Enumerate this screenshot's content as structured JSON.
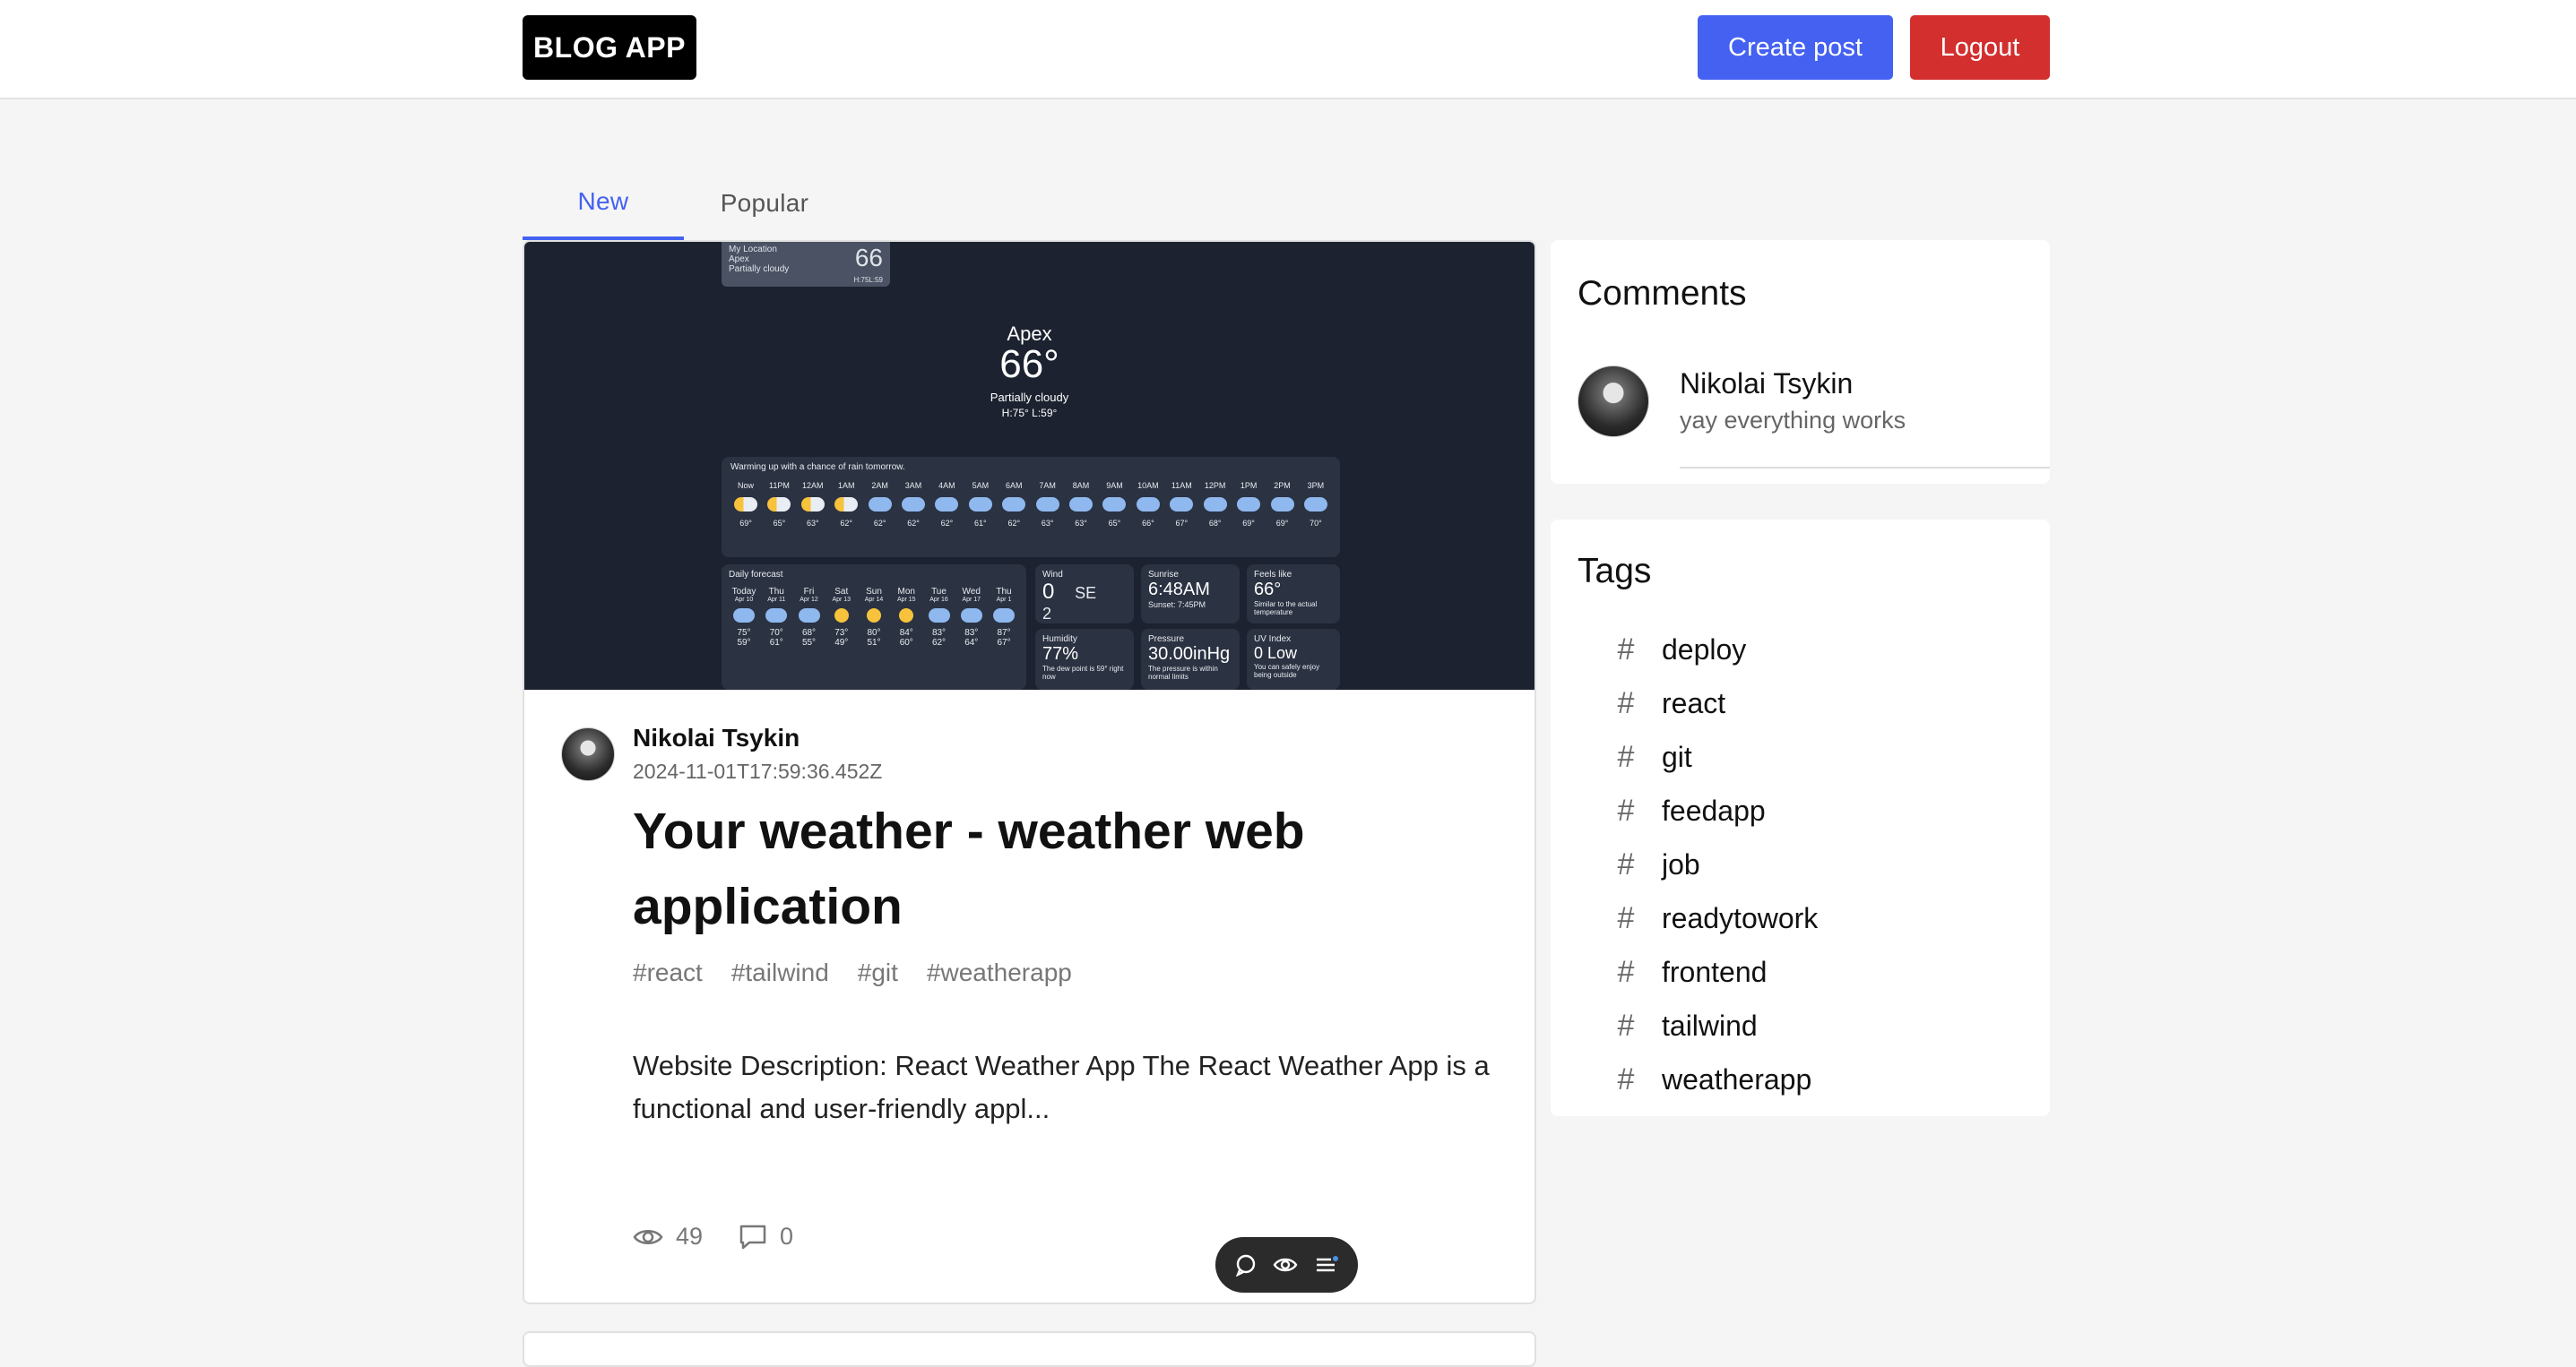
{
  "header": {
    "logo": "BLOG APP",
    "create_post": "Create post",
    "logout": "Logout"
  },
  "tabs": [
    {
      "label": "New",
      "active": true
    },
    {
      "label": "Popular",
      "active": false
    }
  ],
  "post": {
    "image": {
      "location_label": "My Location",
      "location_sub": "Apex",
      "location_cond": "Partially cloudy",
      "location_hl": "H:75L:59",
      "location_temp": "66",
      "city": "Apex",
      "temp": "66°",
      "condition": "Partially cloudy",
      "hilo": "H:75°  L:59°",
      "summary": "Warming up with a chance of rain tomorrow.",
      "hours": [
        "Now",
        "11PM",
        "12AM",
        "1AM",
        "2AM",
        "3AM",
        "4AM",
        "5AM",
        "6AM",
        "7AM",
        "8AM",
        "9AM",
        "10AM",
        "11AM",
        "12PM",
        "1PM",
        "2PM",
        "3PM"
      ],
      "hour_temps": [
        "69°",
        "65°",
        "63°",
        "62°",
        "62°",
        "62°",
        "62°",
        "61°",
        "62°",
        "63°",
        "63°",
        "65°",
        "66°",
        "67°",
        "68°",
        "69°",
        "69°",
        "70°"
      ],
      "daily_label": "Daily forecast",
      "days": [
        "Today",
        "Thu",
        "Fri",
        "Sat",
        "Sun",
        "Mon",
        "Tue",
        "Wed",
        "Thu"
      ],
      "day_dates": [
        "Apr 10",
        "Apr 11",
        "Apr 12",
        "Apr 13",
        "Apr 14",
        "Apr 15",
        "Apr 16",
        "Apr 17",
        "Apr 1"
      ],
      "day_highs": [
        "75°",
        "70°",
        "68°",
        "73°",
        "80°",
        "84°",
        "83°",
        "83°",
        "87°"
      ],
      "day_lows": [
        "59°",
        "61°",
        "55°",
        "49°",
        "51°",
        "60°",
        "62°",
        "64°",
        "67°"
      ],
      "wind_label": "Wind",
      "wind_value": "0",
      "gusts_value": "2",
      "wind_dir": "SE",
      "sunrise_label": "Sunrise",
      "sunrise_value": "6:48AM",
      "sunset": "Sunset: 7:45PM",
      "feels_label": "Feels like",
      "feels_value": "66°",
      "feels_note": "Similar to the actual temperature",
      "humidity_label": "Humidity",
      "humidity_value": "77%",
      "humidity_note": "The dew point is 59° right now",
      "pressure_label": "Pressure",
      "pressure_value": "30.00inHg",
      "pressure_note": "The pressure is within normal limits",
      "uv_label": "UV Index",
      "uv_value": "0 Low",
      "uv_note": "You can safely enjoy being outside"
    },
    "author": "Nikolai Tsykin",
    "date": "2024-11-01T17:59:36.452Z",
    "title": "Your weather - weather web application",
    "tags": [
      "#react",
      "#tailwind",
      "#git",
      "#weatherapp"
    ],
    "description": "Website Description: React Weather App The React Weather App is a functional and user-friendly appl...",
    "views": "49",
    "comments": "0"
  },
  "comments": {
    "title": "Comments",
    "items": [
      {
        "author": "Nikolai Tsykin",
        "text": "yay everything works"
      }
    ]
  },
  "tags": {
    "title": "Tags",
    "items": [
      "deploy",
      "react",
      "git",
      "feedapp",
      "job",
      "readytowork",
      "frontend",
      "tailwind",
      "weatherapp"
    ]
  }
}
